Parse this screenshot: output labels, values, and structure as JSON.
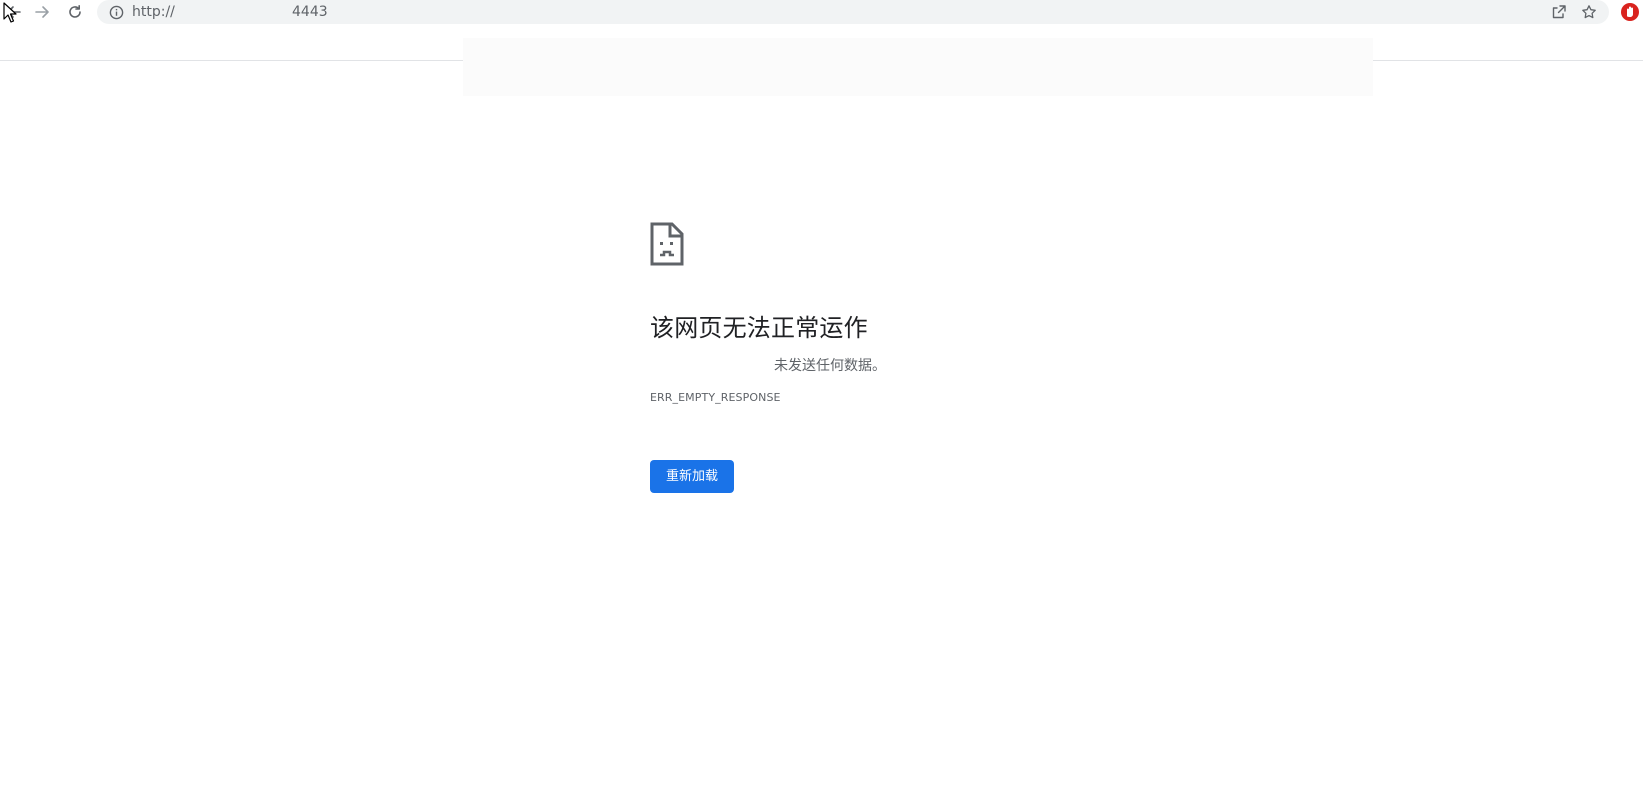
{
  "browser": {
    "url_scheme": "http://",
    "url_port": "4443",
    "icons": {
      "back": "back-arrow-icon",
      "forward": "forward-arrow-icon",
      "reload": "reload-icon",
      "info": "info-icon",
      "share": "share-icon",
      "bookmark": "star-icon",
      "extension": "adblock-icon"
    }
  },
  "error": {
    "title": "该网页无法正常运作",
    "description": "未发送任何数据。",
    "code": "ERR_EMPTY_RESPONSE",
    "reload_label": "重新加载",
    "icon": "sad-page-icon"
  },
  "colors": {
    "button_blue": "#1a73e8",
    "text_primary": "#202124",
    "text_secondary": "#5f6368",
    "omnibox_bg": "#f1f3f4",
    "extension_red": "#d9231e"
  }
}
